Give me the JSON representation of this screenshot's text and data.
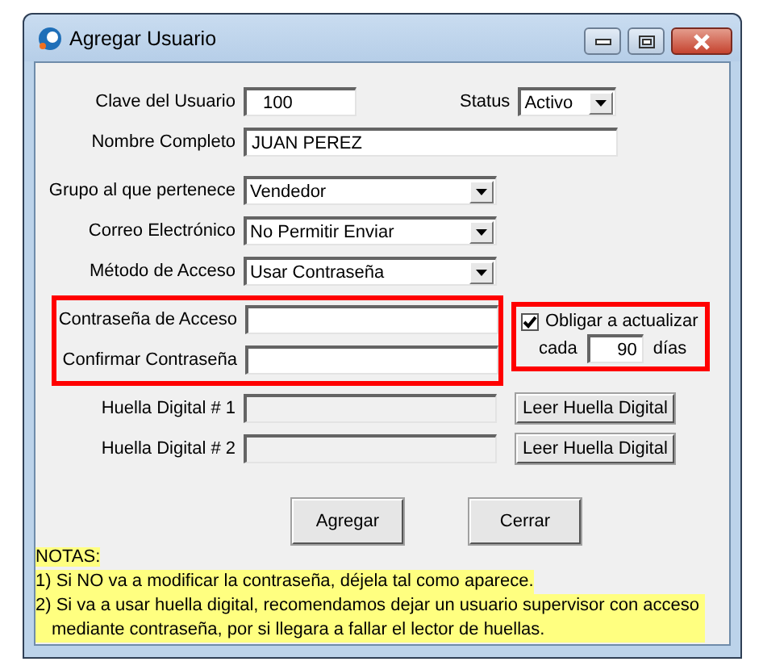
{
  "window": {
    "title": "Agregar Usuario"
  },
  "user_id": {
    "label": "Clave del Usuario",
    "value": "100"
  },
  "status": {
    "label": "Status",
    "value": "Activo"
  },
  "full_name": {
    "label": "Nombre Completo",
    "value": "JUAN PEREZ"
  },
  "selects": [
    {
      "label": "Grupo al que pertenece",
      "value": "Vendedor"
    },
    {
      "label": "Correo Electrónico",
      "value": "No Permitir Enviar"
    },
    {
      "label": "Método de Acceso",
      "value": "Usar Contraseña"
    }
  ],
  "password_fields": [
    {
      "label": "Contraseña de Acceso"
    },
    {
      "label": "Confirmar Contraseña"
    }
  ],
  "force_update": {
    "label": "Obligar a actualizar",
    "checked": true,
    "prefix": "cada",
    "value": "90",
    "suffix": "días"
  },
  "fingerprints": [
    {
      "label": "Huella Digital # 1",
      "disabled": true,
      "button": "Leer Huella Digital"
    },
    {
      "label": "Huella Digital # 2",
      "disabled": true,
      "button": "Leer Huella Digital"
    }
  ],
  "buttons": [
    "Agregar",
    "Cerrar"
  ],
  "notes": [
    "NOTAS:",
    "1) Si NO va a modificar la contraseña, déjela tal como aparece.",
    "2) Si va a usar huella digital, recomendamos dejar un usuario supervisor con acceso mediante contraseña, por si llegara a fallar el lector de huellas."
  ]
}
